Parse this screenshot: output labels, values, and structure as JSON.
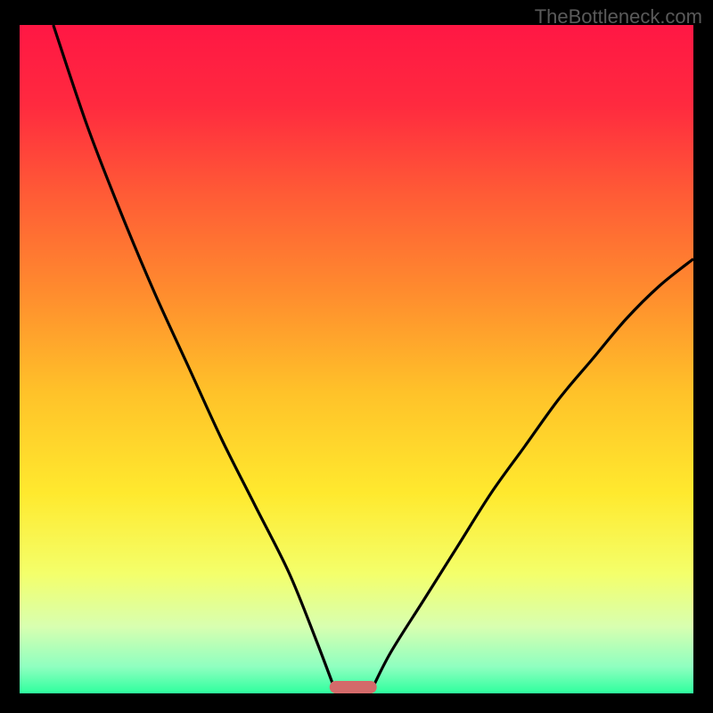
{
  "attribution": "TheBottleneck.com",
  "chart_data": {
    "type": "line",
    "title": "",
    "xlabel": "",
    "ylabel": "",
    "xlim": [
      0,
      100
    ],
    "ylim": [
      0,
      100
    ],
    "series": [
      {
        "name": "left-curve",
        "x": [
          5,
          10,
          15,
          20,
          25,
          30,
          35,
          40,
          44,
          47
        ],
        "y": [
          100,
          85,
          72,
          60,
          49,
          38,
          28,
          18,
          8,
          0
        ]
      },
      {
        "name": "right-curve",
        "x": [
          52,
          55,
          60,
          65,
          70,
          75,
          80,
          85,
          90,
          95,
          100
        ],
        "y": [
          0,
          6,
          14,
          22,
          30,
          37,
          44,
          50,
          56,
          61,
          65
        ]
      }
    ],
    "marker": {
      "x_range": [
        46,
        53
      ],
      "y": 0,
      "color": "#d46a6a"
    },
    "gradient_stops": [
      {
        "offset": 0,
        "color": "#ff1744"
      },
      {
        "offset": 12,
        "color": "#ff2a3f"
      },
      {
        "offset": 25,
        "color": "#ff5a36"
      },
      {
        "offset": 40,
        "color": "#ff8c2e"
      },
      {
        "offset": 55,
        "color": "#ffc229"
      },
      {
        "offset": 70,
        "color": "#ffe92e"
      },
      {
        "offset": 82,
        "color": "#f4ff6a"
      },
      {
        "offset": 90,
        "color": "#d8ffb0"
      },
      {
        "offset": 96,
        "color": "#8fffc0"
      },
      {
        "offset": 100,
        "color": "#2eff9e"
      }
    ]
  }
}
